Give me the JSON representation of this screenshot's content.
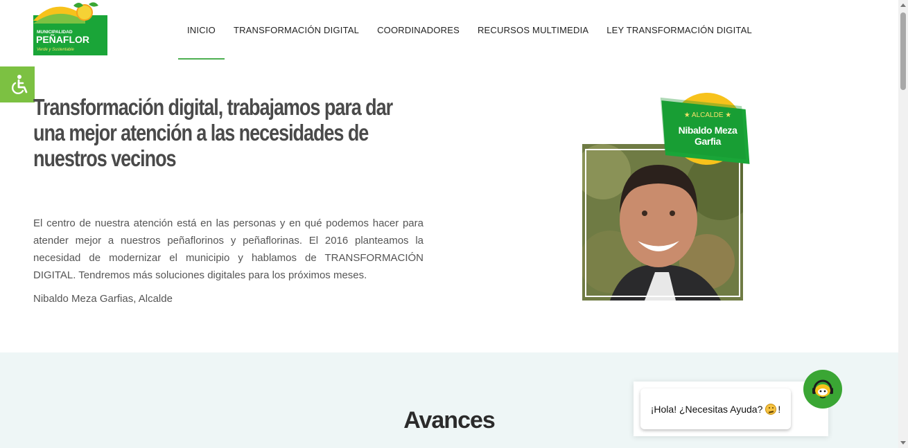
{
  "logo": {
    "line1": "MUNICIPALIDAD",
    "line2": "PEÑAFLOR",
    "tagline": "Verde y Sustentable",
    "colors": {
      "green": "#1aa538",
      "yellow": "#f7c21b",
      "sun": "#f5d235"
    }
  },
  "nav": {
    "items": [
      {
        "label": "INICIO",
        "active": true
      },
      {
        "label": "TRANSFORMACIÓN DIGITAL"
      },
      {
        "label": "COORDINADORES"
      },
      {
        "label": "RECURSOS MULTIMEDIA"
      },
      {
        "label": "LEY TRANSFORMACIÓN DIGITAL"
      }
    ]
  },
  "accessibility": {
    "icon": "wheelchair-icon",
    "color": "#7cc142"
  },
  "hero": {
    "title_lines": [
      "Transformación digital, trabajamos para dar",
      "una mejor atención a las necesidades de",
      "nuestros vecinos"
    ],
    "body": "El centro de nuestra atención está en las personas y en qué podemos hacer para atender mejor a nuestros peñaflorinos y peñaflorinas. El 2016 planteamos la necesidad de modernizar el municipio y hablamos de TRANSFORMACIÓN DIGITAL. Tendremos más soluciones digitales para los próximos meses.",
    "signature": "Nibaldo Meza Garfias, Alcalde"
  },
  "badge": {
    "small": "★ ALCALDE ★",
    "name": "Nibaldo Meza Garfia"
  },
  "section": {
    "title": "Avances"
  },
  "chat": {
    "message": "¡Hola! ¿Necesitas Ayuda?",
    "suffix": "!",
    "fab_icon": "chatbot-headset-icon",
    "accent": "#3aa634"
  }
}
